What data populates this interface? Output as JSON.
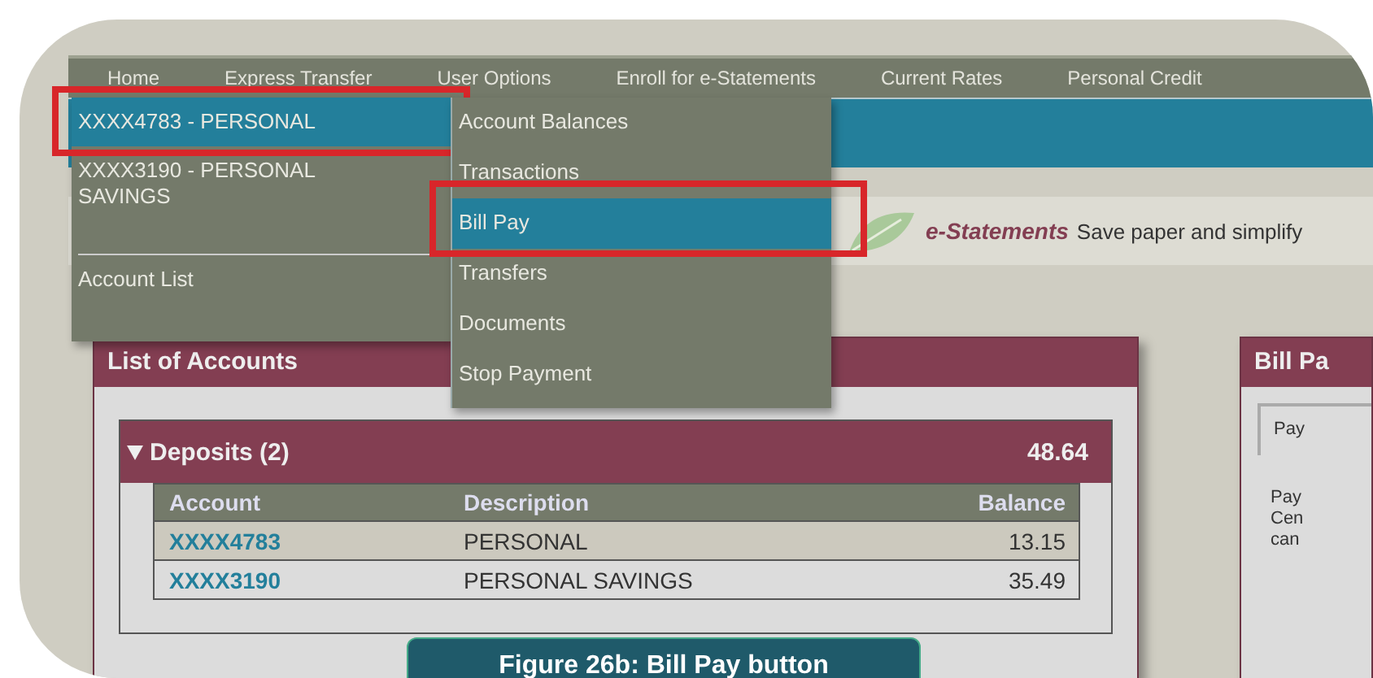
{
  "nav": {
    "items": [
      "Home",
      "Express Transfer",
      "User Options",
      "Enroll for e-Statements",
      "Current Rates",
      "Personal Credit"
    ]
  },
  "account_menu": {
    "items": [
      {
        "label": "XXXX4783 - PERSONAL",
        "selected": true,
        "annotated": true
      },
      {
        "label": "XXXX3190 - PERSONAL SAVINGS",
        "selected": false,
        "annotated": false
      }
    ],
    "footer": "Account List"
  },
  "submenu": {
    "items": [
      {
        "label": "Account Balances",
        "selected": false,
        "annotated": false
      },
      {
        "label": "Transactions",
        "selected": false,
        "annotated": false
      },
      {
        "label": "Bill Pay",
        "selected": true,
        "annotated": true
      },
      {
        "label": "Transfers",
        "selected": false,
        "annotated": false
      },
      {
        "label": "Documents",
        "selected": false,
        "annotated": false
      },
      {
        "label": "Stop Payment",
        "selected": false,
        "annotated": false
      }
    ]
  },
  "banner": {
    "brand": "e-Statements",
    "text": "Save paper and simplify"
  },
  "accounts_panel": {
    "title": "List of Accounts",
    "group": {
      "title": "Deposits (2)",
      "expanded": true,
      "total": "48.64"
    },
    "columns": [
      "Account",
      "Description",
      "Balance"
    ],
    "rows": [
      {
        "account": "XXXX4783",
        "description": "PERSONAL",
        "balance": "13.15",
        "selected": true
      },
      {
        "account": "XXXX3190",
        "description": "PERSONAL SAVINGS",
        "balance": "35.49",
        "selected": false
      }
    ]
  },
  "bill_pay_panel": {
    "title": "Bill Pa",
    "tab": "Pay",
    "lines": [
      "Pay",
      "Cen",
      "can"
    ]
  },
  "caption": "Figure 26b: Bill Pay button"
}
